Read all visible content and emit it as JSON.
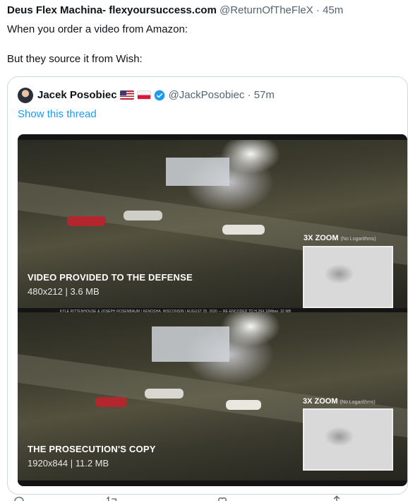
{
  "tweet": {
    "author_name": "Deus Flex Machina- flexyoursuccess.com",
    "handle": "@ReturnOfTheFleX",
    "separator": "·",
    "time": "45m",
    "line1": "When you order a video from Amazon:",
    "line2": "But they source it from Wish:"
  },
  "quote": {
    "author_name": "Jacek Posobiec",
    "flags": [
      "flag-us-icon",
      "flag-pl-icon"
    ],
    "verified_icon": "verified-badge-icon",
    "handle": "@JackPosobiec",
    "separator": "·",
    "time": "57m",
    "show_thread": "Show this thread"
  },
  "media": {
    "top": {
      "zoom_label": "3X ZOOM",
      "zoom_note": "(No Logarithms)",
      "title": "VIDEO PROVIDED TO THE DEFENSE",
      "subtitle": "480x212 | 3.6 MB"
    },
    "credit": "KYLE RITTENHOUSE & JOSEPH ROSENBAUM | KENOSHA, WISCONSIN | AUGUST 25, 2020 — RE-ENCODED TO H.264,10Mbps, 32 MB",
    "bottom": {
      "zoom_label": "3X ZOOM",
      "zoom_note": "(No Logarithms)",
      "title": "THE PROSECUTION'S COPY",
      "subtitle": "1920x844 | 11.2 MB"
    }
  },
  "actions": {
    "icons": [
      "reply-icon",
      "retweet-icon",
      "like-icon",
      "share-icon"
    ]
  },
  "colors": {
    "link": "#1d9bf0",
    "secondary_text": "#536471",
    "border": "#cfd9de"
  }
}
